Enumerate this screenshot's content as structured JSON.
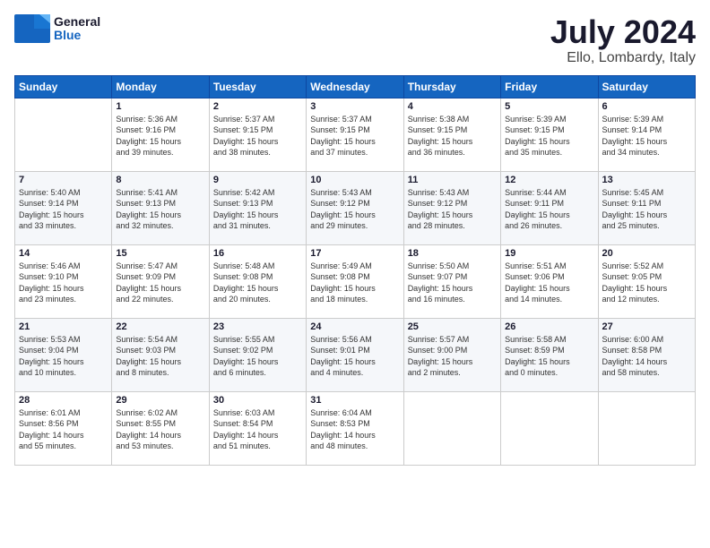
{
  "header": {
    "logo_line1": "General",
    "logo_line2": "Blue",
    "month_year": "July 2024",
    "location": "Ello, Lombardy, Italy"
  },
  "weekdays": [
    "Sunday",
    "Monday",
    "Tuesday",
    "Wednesday",
    "Thursday",
    "Friday",
    "Saturday"
  ],
  "weeks": [
    [
      {
        "day": "",
        "info": ""
      },
      {
        "day": "1",
        "info": "Sunrise: 5:36 AM\nSunset: 9:16 PM\nDaylight: 15 hours\nand 39 minutes."
      },
      {
        "day": "2",
        "info": "Sunrise: 5:37 AM\nSunset: 9:15 PM\nDaylight: 15 hours\nand 38 minutes."
      },
      {
        "day": "3",
        "info": "Sunrise: 5:37 AM\nSunset: 9:15 PM\nDaylight: 15 hours\nand 37 minutes."
      },
      {
        "day": "4",
        "info": "Sunrise: 5:38 AM\nSunset: 9:15 PM\nDaylight: 15 hours\nand 36 minutes."
      },
      {
        "day": "5",
        "info": "Sunrise: 5:39 AM\nSunset: 9:15 PM\nDaylight: 15 hours\nand 35 minutes."
      },
      {
        "day": "6",
        "info": "Sunrise: 5:39 AM\nSunset: 9:14 PM\nDaylight: 15 hours\nand 34 minutes."
      }
    ],
    [
      {
        "day": "7",
        "info": "Sunrise: 5:40 AM\nSunset: 9:14 PM\nDaylight: 15 hours\nand 33 minutes."
      },
      {
        "day": "8",
        "info": "Sunrise: 5:41 AM\nSunset: 9:13 PM\nDaylight: 15 hours\nand 32 minutes."
      },
      {
        "day": "9",
        "info": "Sunrise: 5:42 AM\nSunset: 9:13 PM\nDaylight: 15 hours\nand 31 minutes."
      },
      {
        "day": "10",
        "info": "Sunrise: 5:43 AM\nSunset: 9:12 PM\nDaylight: 15 hours\nand 29 minutes."
      },
      {
        "day": "11",
        "info": "Sunrise: 5:43 AM\nSunset: 9:12 PM\nDaylight: 15 hours\nand 28 minutes."
      },
      {
        "day": "12",
        "info": "Sunrise: 5:44 AM\nSunset: 9:11 PM\nDaylight: 15 hours\nand 26 minutes."
      },
      {
        "day": "13",
        "info": "Sunrise: 5:45 AM\nSunset: 9:11 PM\nDaylight: 15 hours\nand 25 minutes."
      }
    ],
    [
      {
        "day": "14",
        "info": "Sunrise: 5:46 AM\nSunset: 9:10 PM\nDaylight: 15 hours\nand 23 minutes."
      },
      {
        "day": "15",
        "info": "Sunrise: 5:47 AM\nSunset: 9:09 PM\nDaylight: 15 hours\nand 22 minutes."
      },
      {
        "day": "16",
        "info": "Sunrise: 5:48 AM\nSunset: 9:08 PM\nDaylight: 15 hours\nand 20 minutes."
      },
      {
        "day": "17",
        "info": "Sunrise: 5:49 AM\nSunset: 9:08 PM\nDaylight: 15 hours\nand 18 minutes."
      },
      {
        "day": "18",
        "info": "Sunrise: 5:50 AM\nSunset: 9:07 PM\nDaylight: 15 hours\nand 16 minutes."
      },
      {
        "day": "19",
        "info": "Sunrise: 5:51 AM\nSunset: 9:06 PM\nDaylight: 15 hours\nand 14 minutes."
      },
      {
        "day": "20",
        "info": "Sunrise: 5:52 AM\nSunset: 9:05 PM\nDaylight: 15 hours\nand 12 minutes."
      }
    ],
    [
      {
        "day": "21",
        "info": "Sunrise: 5:53 AM\nSunset: 9:04 PM\nDaylight: 15 hours\nand 10 minutes."
      },
      {
        "day": "22",
        "info": "Sunrise: 5:54 AM\nSunset: 9:03 PM\nDaylight: 15 hours\nand 8 minutes."
      },
      {
        "day": "23",
        "info": "Sunrise: 5:55 AM\nSunset: 9:02 PM\nDaylight: 15 hours\nand 6 minutes."
      },
      {
        "day": "24",
        "info": "Sunrise: 5:56 AM\nSunset: 9:01 PM\nDaylight: 15 hours\nand 4 minutes."
      },
      {
        "day": "25",
        "info": "Sunrise: 5:57 AM\nSunset: 9:00 PM\nDaylight: 15 hours\nand 2 minutes."
      },
      {
        "day": "26",
        "info": "Sunrise: 5:58 AM\nSunset: 8:59 PM\nDaylight: 15 hours\nand 0 minutes."
      },
      {
        "day": "27",
        "info": "Sunrise: 6:00 AM\nSunset: 8:58 PM\nDaylight: 14 hours\nand 58 minutes."
      }
    ],
    [
      {
        "day": "28",
        "info": "Sunrise: 6:01 AM\nSunset: 8:56 PM\nDaylight: 14 hours\nand 55 minutes."
      },
      {
        "day": "29",
        "info": "Sunrise: 6:02 AM\nSunset: 8:55 PM\nDaylight: 14 hours\nand 53 minutes."
      },
      {
        "day": "30",
        "info": "Sunrise: 6:03 AM\nSunset: 8:54 PM\nDaylight: 14 hours\nand 51 minutes."
      },
      {
        "day": "31",
        "info": "Sunrise: 6:04 AM\nSunset: 8:53 PM\nDaylight: 14 hours\nand 48 minutes."
      },
      {
        "day": "",
        "info": ""
      },
      {
        "day": "",
        "info": ""
      },
      {
        "day": "",
        "info": ""
      }
    ]
  ]
}
